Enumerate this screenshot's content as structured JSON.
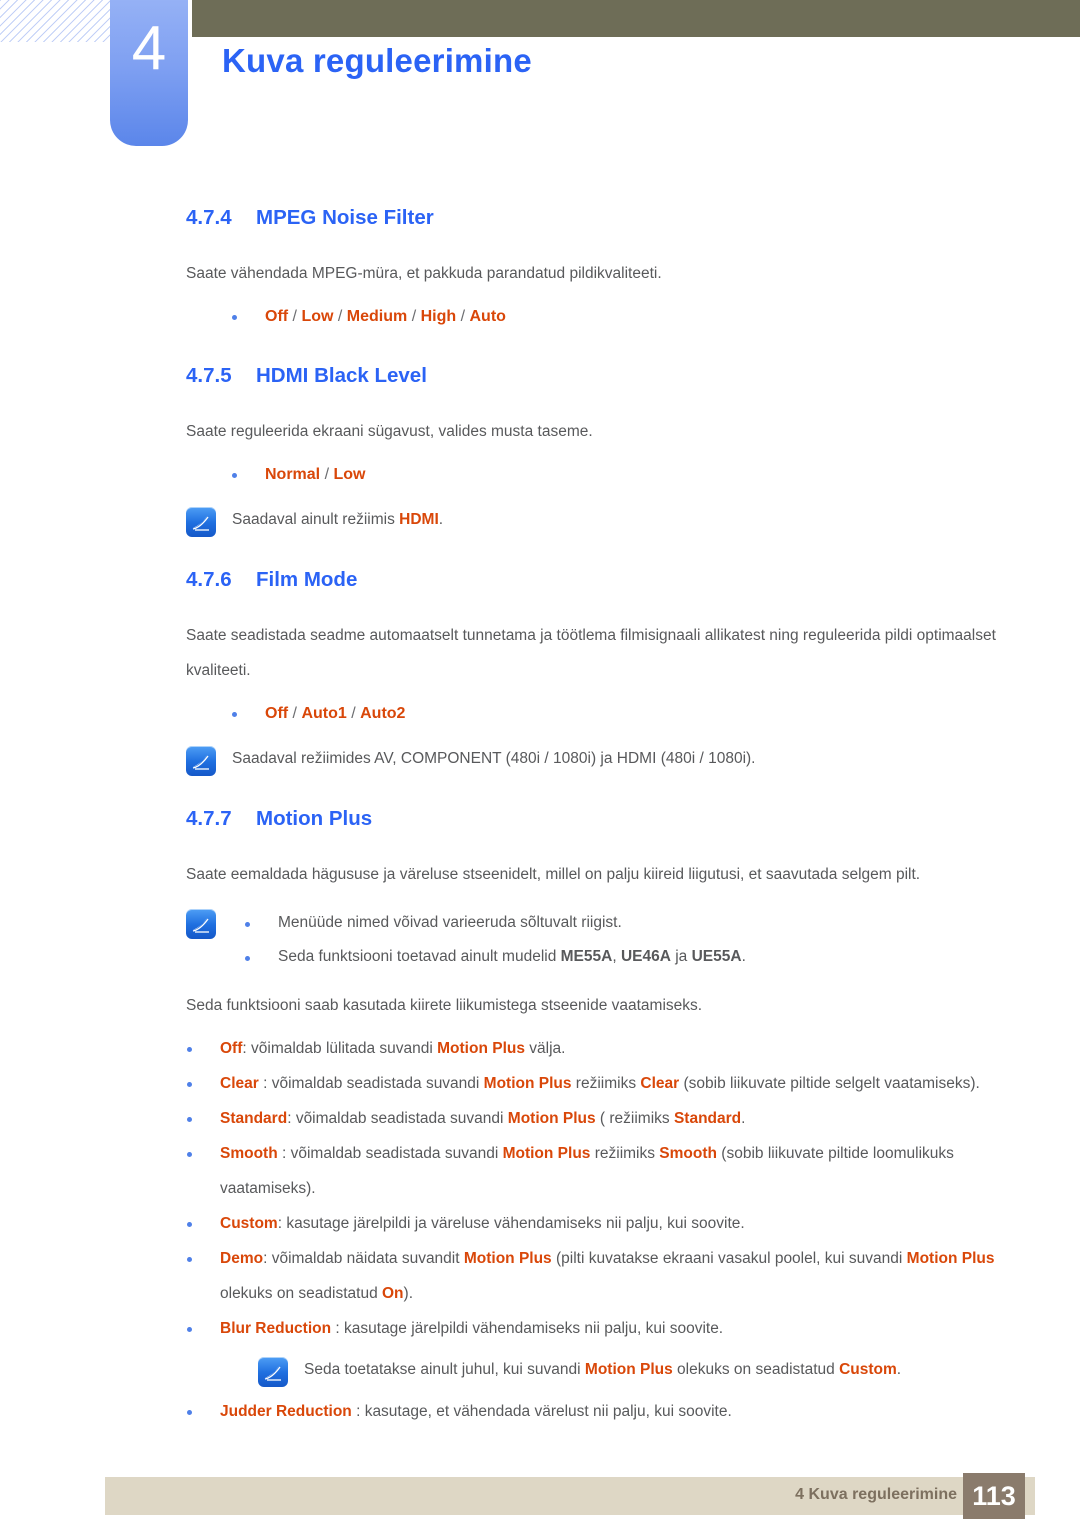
{
  "header": {
    "chapter_number": "4",
    "chapter_title": "Kuva reguleerimine"
  },
  "sections": [
    {
      "number": "4.7.4",
      "title": "MPEG Noise Filter",
      "body": "Saate vähendada MPEG-müra, et pakkuda parandatud pildikvaliteeti.",
      "options": [
        "Off",
        "Low",
        "Medium",
        "High",
        "Auto"
      ]
    },
    {
      "number": "4.7.5",
      "title": "HDMI Black Level",
      "body": "Saate reguleerida ekraani sügavust, valides musta taseme.",
      "options": [
        "Normal",
        "Low"
      ],
      "note_pre": "Saadaval ainult režiimis ",
      "note_kw": "HDMI",
      "note_post": "."
    },
    {
      "number": "4.7.6",
      "title": "Film Mode",
      "body": "Saate seadistada seadme automaatselt tunnetama ja töötlema filmisignaali allikatest ning reguleerida pildi optimaalset kvaliteeti.",
      "options": [
        "Off",
        "Auto1",
        "Auto2"
      ],
      "note": "Saadaval režiimides AV, COMPONENT (480i / 1080i) ja HDMI (480i / 1080i)."
    },
    {
      "number": "4.7.7",
      "title": "Motion Plus",
      "body": "Saate eemaldada hägususe ja väreluse stseenidelt, millel on palju kiireid liigutusi, et saavutada selgem pilt."
    }
  ],
  "motion_plus": {
    "note_bullets": [
      {
        "pre": "Menüüde nimed võivad varieeruda sõltuvalt riigist.",
        "models": []
      },
      {
        "pre": "Seda funktsiooni toetavad ainult mudelid ",
        "models": [
          "ME55A",
          "UE46A",
          "UE55A"
        ],
        "joiner": ", ",
        "last_joiner": " ja ",
        "post": "."
      }
    ],
    "intro": "Seda funktsiooni saab kasutada kiirete liikumistega stseenide vaatamiseks.",
    "items": [
      {
        "term": "Off",
        "sep": ": ",
        "parts": [
          {
            "t": "võimaldab lülitada suvandi ",
            "k": false
          },
          {
            "t": "Motion Plus",
            "k": true
          },
          {
            "t": " välja.",
            "k": false
          }
        ]
      },
      {
        "term": "Clear",
        "sep": " : ",
        "parts": [
          {
            "t": "võimaldab seadistada suvandi ",
            "k": false
          },
          {
            "t": "Motion Plus",
            "k": true
          },
          {
            "t": " režiimiks ",
            "k": false
          },
          {
            "t": "Clear",
            "k": true
          },
          {
            "t": " (sobib liikuvate piltide selgelt vaatamiseks).",
            "k": false
          }
        ]
      },
      {
        "term": "Standard",
        "sep": ": ",
        "parts": [
          {
            "t": "võimaldab seadistada suvandi ",
            "k": false
          },
          {
            "t": "Motion Plus",
            "k": true
          },
          {
            "t": " ( režiimiks ",
            "k": false
          },
          {
            "t": "Standard",
            "k": true
          },
          {
            "t": ".",
            "k": false
          }
        ]
      },
      {
        "term": "Smooth",
        "sep": " : ",
        "parts": [
          {
            "t": "võimaldab seadistada suvandi ",
            "k": false
          },
          {
            "t": "Motion Plus",
            "k": true
          },
          {
            "t": " režiimiks ",
            "k": false
          },
          {
            "t": "Smooth",
            "k": true
          },
          {
            "t": " (sobib liikuvate piltide loomulikuks vaatamiseks).",
            "k": false
          }
        ]
      },
      {
        "term": "Custom",
        "sep": ": ",
        "parts": [
          {
            "t": "kasutage järelpildi ja väreluse vähendamiseks nii palju, kui soovite.",
            "k": false
          }
        ]
      },
      {
        "term": "Demo",
        "sep": ": ",
        "parts": [
          {
            "t": "võimaldab näidata suvandit ",
            "k": false
          },
          {
            "t": "Motion Plus",
            "k": true
          },
          {
            "t": " (pilti kuvatakse ekraani vasakul poolel, kui suvandi ",
            "k": false
          },
          {
            "t": "Motion Plus",
            "k": true
          },
          {
            "t": " olekuks on seadistatud ",
            "k": false
          },
          {
            "t": "On",
            "k": true
          },
          {
            "t": ").",
            "k": false
          }
        ]
      },
      {
        "term": "Blur Reduction",
        "sep": " : ",
        "parts": [
          {
            "t": "kasutage järelpildi vähendamiseks nii palju, kui soovite.",
            "k": false
          }
        ]
      }
    ],
    "blur_note": {
      "parts": [
        {
          "t": "Seda toetatakse ainult juhul, kui suvandi ",
          "k": false
        },
        {
          "t": "Motion Plus",
          "k": true
        },
        {
          "t": " olekuks on seadistatud ",
          "k": false
        },
        {
          "t": "Custom",
          "k": true
        },
        {
          "t": ".",
          "k": false
        }
      ]
    },
    "judder": {
      "term": "Judder Reduction",
      "sep": " : ",
      "parts": [
        {
          "t": "kasutage, et vähendada värelust nii palju, kui soovite.",
          "k": false
        }
      ]
    }
  },
  "footer": {
    "label": "4 Kuva reguleerimine",
    "page": "113"
  },
  "colors": {
    "heading_blue": "#2b63f5",
    "option_orange": "#d94709",
    "body_gray": "#58595b",
    "olive": "#6e6d57",
    "footer_beige": "#ded7c5",
    "footer_taupe": "#8a7b6c",
    "tab_blue": "#5b86ea"
  },
  "icons": {
    "note": "note-pen-icon"
  }
}
